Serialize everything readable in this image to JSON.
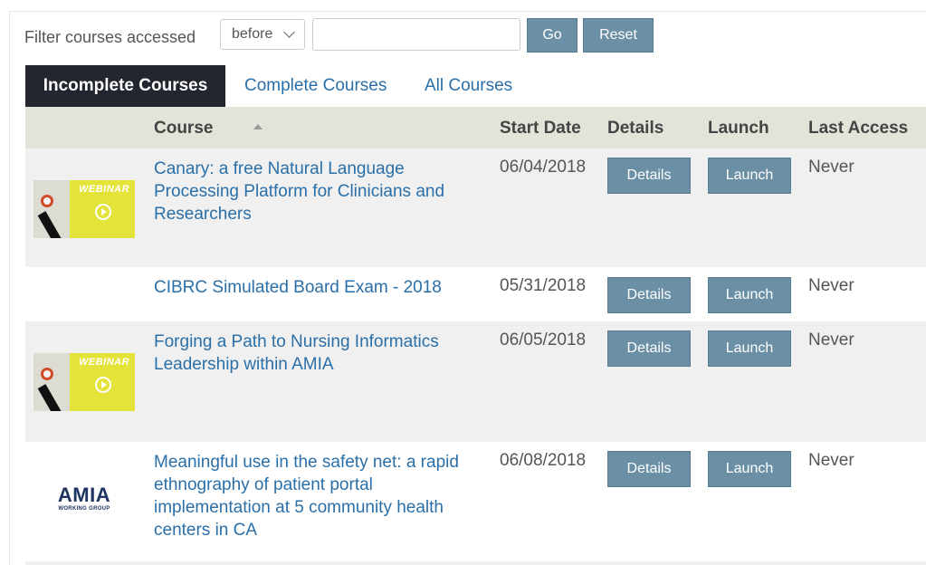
{
  "filter": {
    "label": "Filter courses accessed",
    "select_value": "before",
    "input_value": "",
    "go_label": "Go",
    "reset_label": "Reset"
  },
  "tabs": [
    {
      "label": "Incomplete Courses",
      "active": true
    },
    {
      "label": "Complete Courses",
      "active": false
    },
    {
      "label": "All Courses",
      "active": false
    }
  ],
  "table": {
    "headers": {
      "course": "Course",
      "start_date": "Start Date",
      "details": "Details",
      "launch": "Launch",
      "last_access": "Last Access"
    },
    "sort_icon": "sort-ascending-icon",
    "rows": [
      {
        "thumbnail": "webinar",
        "thumbnail_text": "WEBINAR",
        "course": "Canary: a free Natural Language Processing Platform for Clinicians and Researchers",
        "start_date": "06/04/2018",
        "details_label": "Details",
        "launch_label": "Launch",
        "last_access": "Never"
      },
      {
        "thumbnail": "none",
        "course": "CIBRC Simulated Board Exam - 2018",
        "start_date": "05/31/2018",
        "details_label": "Details",
        "launch_label": "Launch",
        "last_access": "Never"
      },
      {
        "thumbnail": "webinar",
        "thumbnail_text": "WEBINAR",
        "course": "Forging a Path to Nursing Informatics Leadership within AMIA",
        "start_date": "06/05/2018",
        "details_label": "Details",
        "launch_label": "Launch",
        "last_access": "Never"
      },
      {
        "thumbnail": "amia",
        "thumbnail_title": "AMIA",
        "thumbnail_subtitle": "WORKING GROUP",
        "course": "Meaningful use in the safety net: a rapid ethnography of patient portal implementation at 5 community health centers in CA",
        "start_date": "06/08/2018",
        "details_label": "Details",
        "launch_label": "Launch",
        "last_access": "Never"
      }
    ]
  },
  "colors": {
    "button": "#6b8fa5",
    "active_tab": "#23262f",
    "link": "#2a6fa8",
    "header_bg": "#e3e3da",
    "row_shade": "#f0f0f0"
  }
}
